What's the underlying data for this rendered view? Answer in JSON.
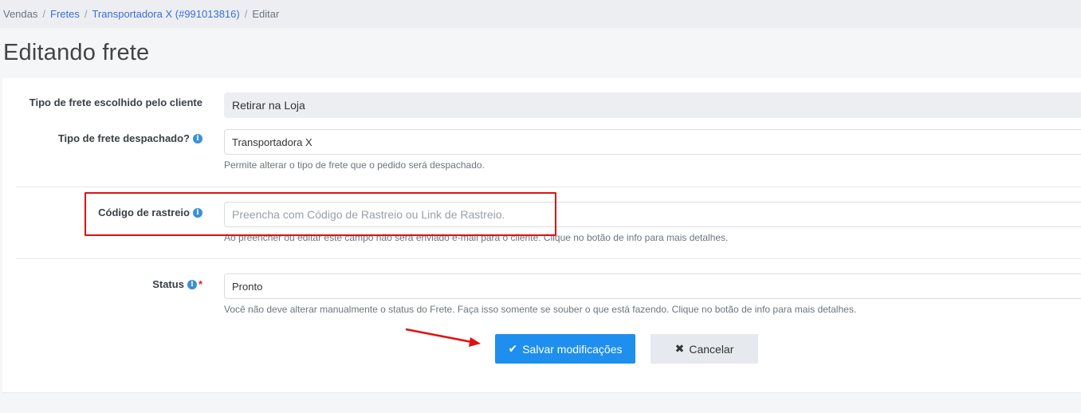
{
  "breadcrumb": {
    "items": [
      {
        "label": "Vendas",
        "link": false
      },
      {
        "label": "Fretes",
        "link": true
      },
      {
        "label": "Transportadora X (#991013816)",
        "link": true
      },
      {
        "label": "Editar",
        "link": false
      }
    ],
    "separator": "/"
  },
  "page": {
    "title": "Editando frete"
  },
  "form": {
    "tipo_escolhido": {
      "label": "Tipo de frete escolhido pelo cliente",
      "value": "Retirar na Loja"
    },
    "tipo_despachado": {
      "label": "Tipo de frete despachado?",
      "value": "Transportadora X",
      "help": "Permite alterar o tipo de frete que o pedido será despachado."
    },
    "codigo_rastreio": {
      "label": "Código de rastreio",
      "value": "",
      "placeholder": "Preencha com Código de Rastreio ou Link de Rastreio.",
      "help": "Ao preencher ou editar este campo não será enviado e-mail para o cliente. Clique no botão de info para mais detalhes."
    },
    "status": {
      "label": "Status",
      "required_mark": "*",
      "value": "Pronto",
      "help": "Você não deve alterar manualmente o status do Frete. Faça isso somente se souber o que está fazendo. Clique no botão de info para mais detalhes."
    }
  },
  "actions": {
    "save_label": "Salvar modificações",
    "cancel_label": "Cancelar"
  },
  "icons": {
    "info": "info-icon",
    "check": "check-icon",
    "close": "close-icon"
  },
  "colors": {
    "primary": "#1e8fef",
    "highlight": "#e01010",
    "link": "#3b6fd4"
  }
}
